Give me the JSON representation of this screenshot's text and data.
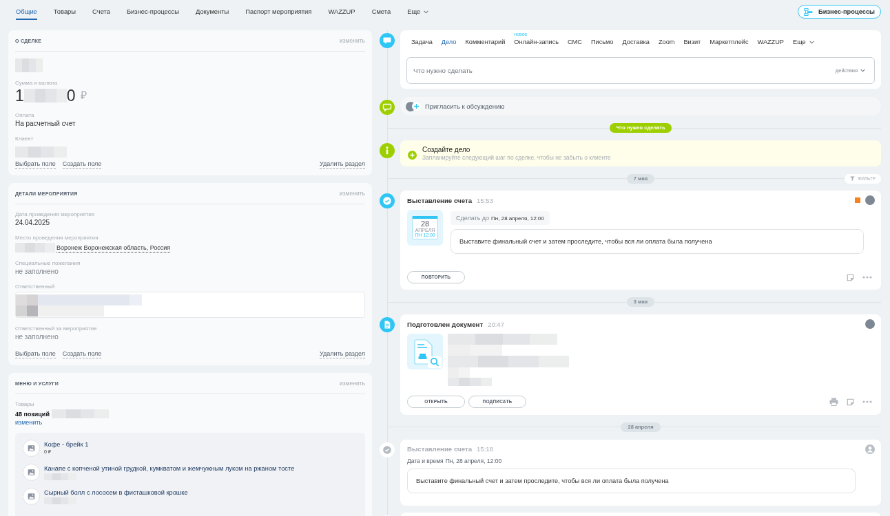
{
  "tabs": [
    {
      "label": "Общие",
      "selected": true
    },
    {
      "label": "Товары",
      "selected": false
    },
    {
      "label": "Счета",
      "selected": false
    },
    {
      "label": "Бизнес-процессы",
      "selected": false
    },
    {
      "label": "Документы",
      "selected": false
    },
    {
      "label": "Паспорт мероприятия",
      "selected": false
    },
    {
      "label": "WAZZUP",
      "selected": false
    },
    {
      "label": "Смета",
      "selected": false
    },
    {
      "label": "Еще",
      "selected": false,
      "kind": "more"
    }
  ],
  "header_button": {
    "label": "Бизнес-процессы"
  },
  "sections": [
    {
      "title": "О СДЕЛКЕ",
      "edit": "изменить",
      "fields": [
        {
          "kind": "redacted"
        },
        {
          "kind": "amount",
          "label": "Сумма и валюта",
          "parts": [
            "1",
            "0"
          ],
          "currency": "₽"
        },
        {
          "kind": "text",
          "label": "Оплата",
          "value": "На расчетный счет",
          "empty": false
        },
        {
          "kind": "redacted",
          "label": "Клиент"
        }
      ],
      "links": [
        "Выбрать поле",
        "Создать поле"
      ],
      "delete": "Удалить раздел"
    },
    {
      "title": "ДЕТАЛИ МЕРОПРИЯТИЯ",
      "edit": "изменить",
      "fields": [
        {
          "kind": "text",
          "label": "Дата проведения мероприятия",
          "value": "24.04.2025",
          "empty": false
        },
        {
          "kind": "address",
          "label": "Место проведения мероприятия",
          "value": "Воронеж Воронежская область, Россия"
        },
        {
          "kind": "text",
          "label": "Специальные пожелания",
          "value": "не заполнено",
          "empty": true
        },
        {
          "kind": "people",
          "label": "Ответственный"
        },
        {
          "kind": "text",
          "label": "Ответственный за мероприятие",
          "value": "не заполнено",
          "empty": true
        }
      ],
      "links": [
        "Выбрать поле",
        "Создать поле"
      ],
      "delete": "Удалить раздел"
    },
    {
      "title": "МЕНЮ И УСЛУГИ",
      "edit": "изменить",
      "fields": [
        {
          "kind": "products",
          "label": "Товары",
          "summary": "48 позиций",
          "edit": "изменить",
          "items": [
            {
              "name": "Кофе - брейк 1",
              "price": "0 ₽"
            },
            {
              "name": "Канапе с копченой утиной грудкой, кумкватом и жемчужным луком на ржаном тосте",
              "redacted": true
            },
            {
              "name": "Сырный болл с лососем в фисташковой крошке",
              "redacted": true
            }
          ]
        }
      ]
    }
  ],
  "timeline": {
    "composer": {
      "tabs": [
        {
          "label": "Задача",
          "selected": false
        },
        {
          "label": "Дело",
          "selected": true
        },
        {
          "label": "Комментарий",
          "selected": false
        },
        {
          "label": "Онлайн-запись",
          "selected": false,
          "badge": "новое"
        },
        {
          "label": "СМС",
          "selected": false
        },
        {
          "label": "Письмо",
          "selected": false
        },
        {
          "label": "Доставка",
          "selected": false
        },
        {
          "label": "Zoom",
          "selected": false
        },
        {
          "label": "Визит",
          "selected": false
        },
        {
          "label": "Маркетплейс",
          "selected": false
        },
        {
          "label": "WAZZUP",
          "selected": false
        },
        {
          "label": "Еще",
          "selected": false,
          "kind": "more"
        }
      ],
      "placeholder": "Что нужно сделать",
      "actions": "действия"
    },
    "invite": "Пригласить к обсуждению",
    "todo_label": "Что нужно сделать",
    "create": {
      "title": "Создайте дело",
      "subtitle": "Запланируйте следующий шаг по сделке, чтобы не забыть о клиенте"
    },
    "entries": [
      {
        "kind": "date",
        "label": "7 мая",
        "filter": "ФИЛЬТР"
      },
      {
        "kind": "task",
        "title": "Выставление счета",
        "time": "15:53",
        "flagged": true,
        "avatar": {
          "kind": "photo"
        },
        "calendar": {
          "day": "28",
          "month": "АПРЕЛЯ",
          "time": "ПН 12:00"
        },
        "deadline_label": "Сделать до",
        "deadline": "Пн, 28 апреля, 12:00",
        "message": "Выставите финальный счет и затем проследите, чтобы вся ли оплата была получена",
        "buttons": [
          "ПОВТОРИТЬ"
        ]
      },
      {
        "kind": "date",
        "label": "3 мая"
      },
      {
        "kind": "document",
        "title": "Подготовлен документ",
        "time": "20:47",
        "flagged": false,
        "avatar": {
          "kind": "photo"
        },
        "buttons": [
          "ОТКРЫТЬ",
          "ПОДПИСАТЬ"
        ]
      },
      {
        "kind": "date",
        "label": "28 апреля"
      },
      {
        "kind": "done",
        "title": "Выставление счета",
        "time": "15:18",
        "flagged": false,
        "avatar": {
          "kind": "generic"
        },
        "deadline_label": "Дата и время",
        "deadline": "Пн, 28 апреля, 12:00",
        "message": "Выставите финальный счет и затем проследите, чтобы вся ли оплата была получена"
      },
      {
        "kind": "cut"
      }
    ]
  }
}
